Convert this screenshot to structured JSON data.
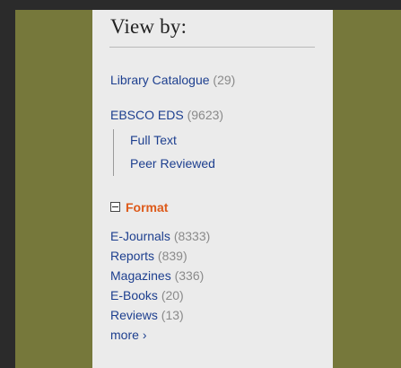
{
  "panel": {
    "title": "View by:",
    "sources": [
      {
        "label": "Library Catalogue",
        "count": "(29)"
      },
      {
        "label": "EBSCO EDS",
        "count": "(9623)"
      }
    ],
    "eds_filters": [
      "Full Text",
      "Peer Reviewed"
    ],
    "format": {
      "heading": "Format",
      "items": [
        {
          "label": "E-Journals",
          "count": "(8333)"
        },
        {
          "label": "Reports",
          "count": "(839)"
        },
        {
          "label": "Magazines",
          "count": "(336)"
        },
        {
          "label": "E-Books",
          "count": "(20)"
        },
        {
          "label": "Reviews",
          "count": "(13)"
        }
      ],
      "more_label": "more",
      "more_icon": "›"
    }
  },
  "colors": {
    "background": "#2b2b2b",
    "olive": "#76783b",
    "panel": "#ebebeb",
    "link": "#1d3f8f",
    "count": "#8a8a8a",
    "format_heading": "#dd5a1a"
  }
}
